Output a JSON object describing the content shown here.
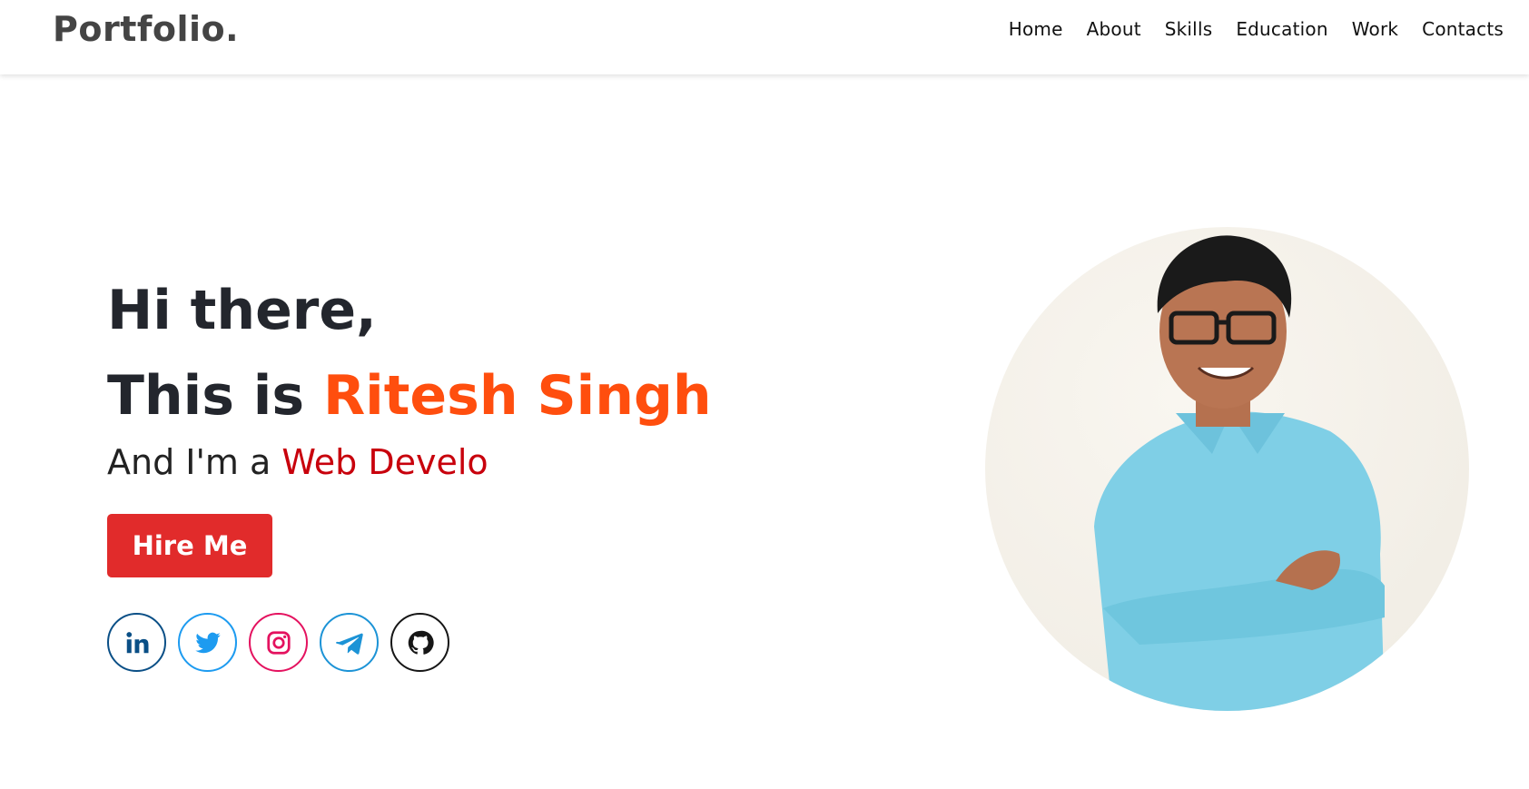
{
  "nav": {
    "brand": "Portfolio",
    "brand_dot": ".",
    "links": [
      {
        "label": "Home"
      },
      {
        "label": "About"
      },
      {
        "label": "Skills"
      },
      {
        "label": "Education"
      },
      {
        "label": "Work"
      },
      {
        "label": "Contacts"
      }
    ]
  },
  "hero": {
    "greeting": "Hi there,",
    "intro_prefix": "This is ",
    "name": "Ritesh Singh",
    "role_prefix": "And I'm a ",
    "role_typed": "Web Develo",
    "hire_button": "Hire Me"
  },
  "socials": [
    {
      "icon": "linkedin-icon",
      "color": "#0a4f86"
    },
    {
      "icon": "twitter-icon",
      "color": "#1d9bf0"
    },
    {
      "icon": "instagram-icon",
      "color": "#e4125f"
    },
    {
      "icon": "telegram-icon",
      "color": "#1c93d6"
    },
    {
      "icon": "github-icon",
      "color": "#161616"
    }
  ],
  "colors": {
    "accent_name": "#ff4e0e",
    "accent_role": "#c8000c",
    "button": "#e12b2b",
    "shirt": "#7fcfe6"
  }
}
